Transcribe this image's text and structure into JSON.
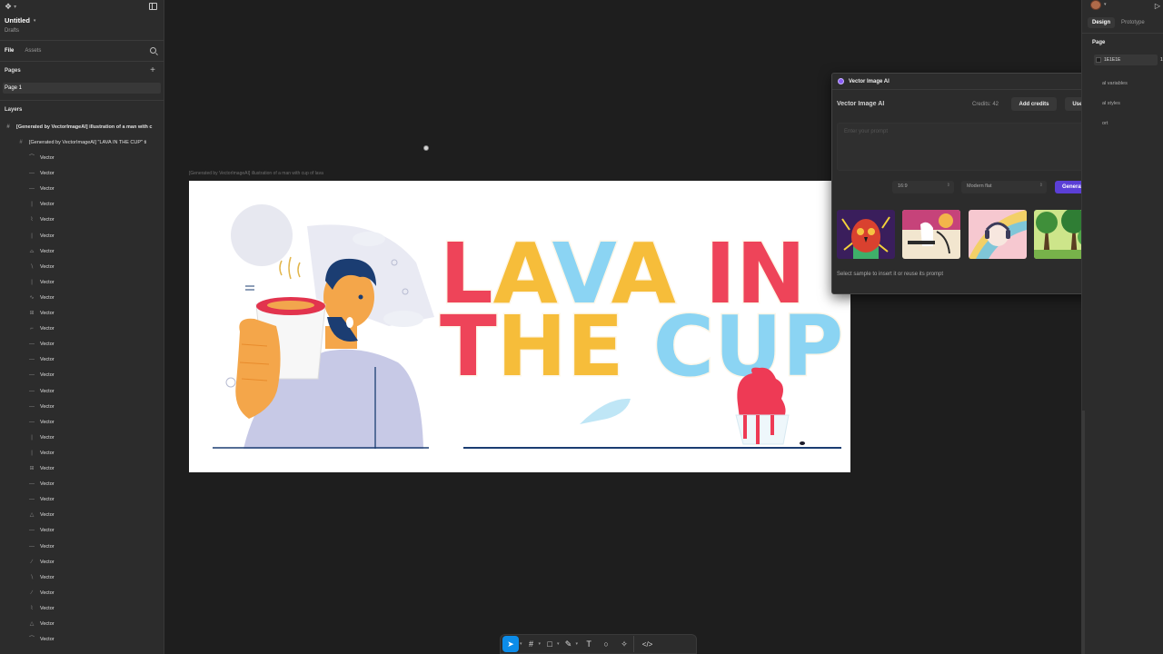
{
  "file": {
    "title": "Untitled",
    "location": "Drafts"
  },
  "left_panel": {
    "tabs": [
      "File",
      "Assets"
    ],
    "pages_label": "Pages",
    "pages": [
      "Page 1"
    ],
    "layers_label": "Layers",
    "layers": [
      "[Generated by VectorImageAI] illustration of a man with c",
      "[Generated by VectorImageAI] \"LAVA IN THE CUP\" ti"
    ],
    "vector_label": "Vector"
  },
  "canvas": {
    "frame_label": "[Generated by VectorImageAI] illustration of a man with cup of lava",
    "artwork": {
      "line1": "LAVA IN",
      "line2": "THE CUP",
      "colors": {
        "red": "#ee4459",
        "yellow": "#f6bd3a",
        "blue": "#8bd4f3",
        "skin": "#f4a64a",
        "shirt": "#c7c9e6",
        "hair": "#1b3d72"
      }
    }
  },
  "plugin": {
    "window_title": "Vector Image AI",
    "name": "Vector Image AI",
    "credits": "Credits: 42",
    "add_credits": "Add credits",
    "user": "User",
    "prompt_placeholder": "Enter your prompt",
    "ratio": "16:9",
    "style": "Modern flat",
    "generate": "Generate",
    "caption": "Select sample to insert it or reuse its prompt",
    "accent": "#5b3fd6"
  },
  "right_panel": {
    "tabs": [
      "Design",
      "Prototype"
    ],
    "page_label": "Page",
    "bg_hex": "1E1E1E",
    "bg_opacity": "1",
    "local_variables": "al variables",
    "local_styles": "al styles",
    "export": "ort"
  },
  "toolbar": {
    "tools": [
      "move-tool",
      "frame-tool",
      "shape-tool",
      "pen-tool",
      "text-tool",
      "comment-tool",
      "actions-tool",
      "dev-mode-tool"
    ],
    "accent": "#0c8ce9"
  }
}
